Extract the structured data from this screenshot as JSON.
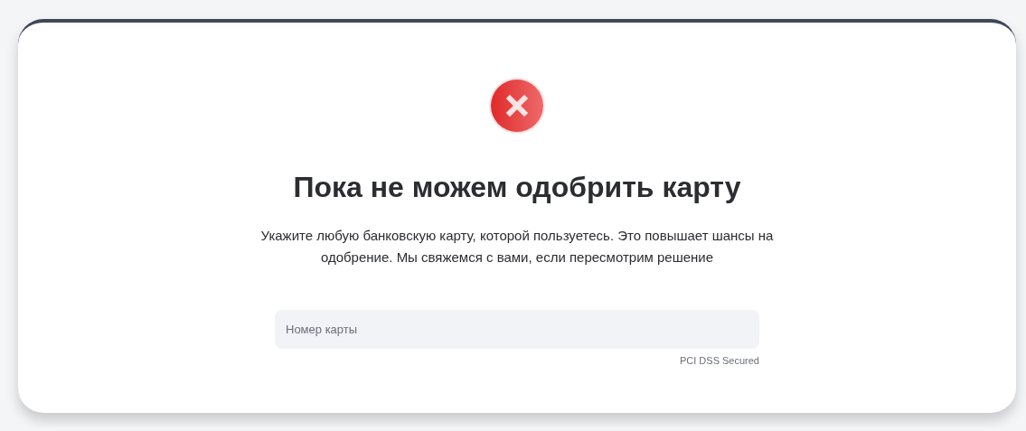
{
  "status": {
    "kind": "error"
  },
  "title": "Пока не можем одобрить карту",
  "message": "Укажите любую банковскую карту, которой пользуетесь. Это повышает шансы на одобрение. Мы свяжемся с вами, если пересмотрим решение",
  "card_field": {
    "placeholder": "Номер карты"
  },
  "security_note": "PCI DSS Secured"
}
